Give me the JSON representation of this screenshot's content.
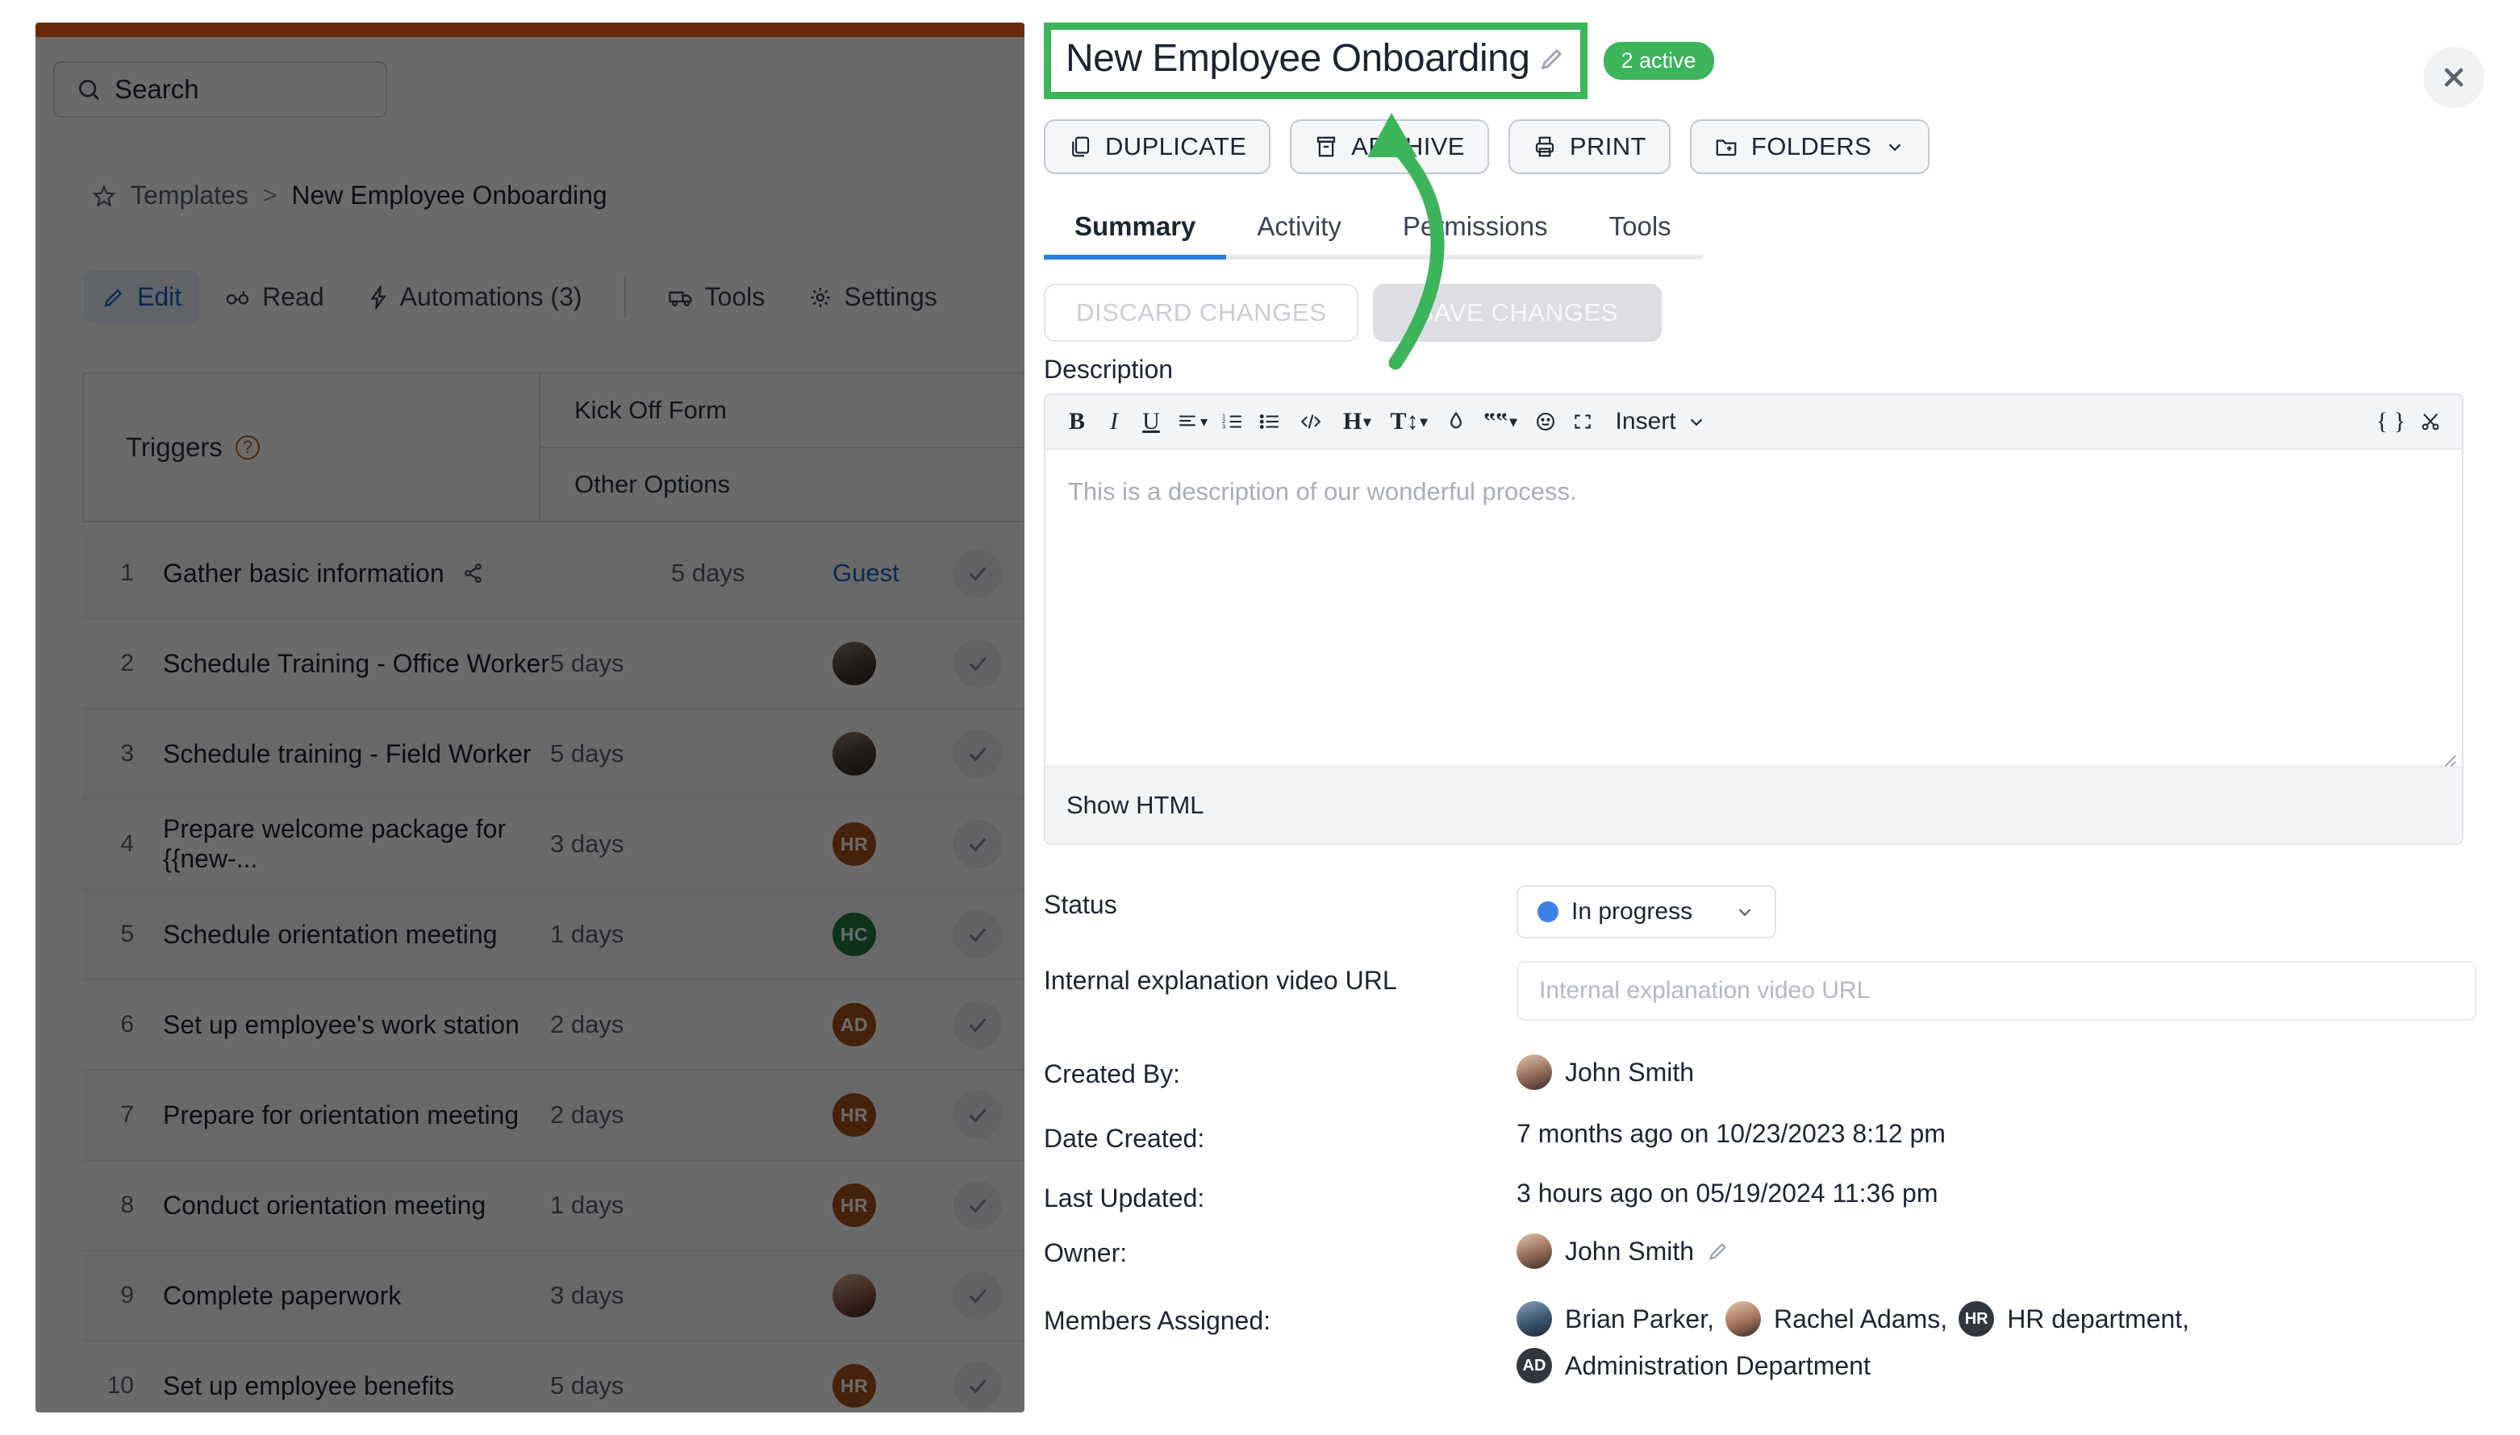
{
  "background_app": {
    "search": {
      "placeholder": "Search",
      "icon": "search-icon"
    },
    "breadcrumb": {
      "star_icon": "star-icon",
      "root": "Templates",
      "separator": ">",
      "current": "New Employee Onboarding"
    },
    "nav_tabs": [
      {
        "label": "Edit",
        "icon": "pencil-icon",
        "active": true
      },
      {
        "label": "Read",
        "icon": "glasses-icon",
        "active": false
      },
      {
        "label": "Automations (3)",
        "icon": "lightning-icon",
        "active": false
      },
      {
        "label": "Tools",
        "icon": "truck-icon",
        "active": false
      },
      {
        "label": "Settings",
        "icon": "gear-icon",
        "active": false
      }
    ],
    "triggers": {
      "label": "Triggers",
      "help_icon": "question-icon",
      "rows": [
        "Kick Off Form",
        "Other Options"
      ]
    },
    "tasks": [
      {
        "num": "1",
        "name": "Gather basic information",
        "share_icon": "share-icon",
        "days": "5 days",
        "assignee": "Guest",
        "assignee_type": "guest"
      },
      {
        "num": "2",
        "name": "Schedule Training - Office Worker",
        "days": "5 days",
        "assignee": "",
        "assignee_type": "photo"
      },
      {
        "num": "3",
        "name": "Schedule training - Field Worker",
        "days": "5 days",
        "assignee": "",
        "assignee_type": "photo"
      },
      {
        "num": "4",
        "name": "Prepare welcome package for {{new-...",
        "days": "3 days",
        "assignee": "HR",
        "assignee_type": "initials-orange"
      },
      {
        "num": "5",
        "name": "Schedule orientation meeting",
        "days": "1 days",
        "assignee": "HC",
        "assignee_type": "initials-green"
      },
      {
        "num": "6",
        "name": "Set up employee's work station",
        "days": "2 days",
        "assignee": "AD",
        "assignee_type": "initials-orange"
      },
      {
        "num": "7",
        "name": "Prepare for orientation meeting",
        "days": "2 days",
        "assignee": "HR",
        "assignee_type": "initials-orange"
      },
      {
        "num": "8",
        "name": "Conduct orientation meeting",
        "days": "1 days",
        "assignee": "HR",
        "assignee_type": "initials-orange"
      },
      {
        "num": "9",
        "name": "Complete paperwork",
        "days": "3 days",
        "assignee": "",
        "assignee_type": "photo2"
      },
      {
        "num": "10",
        "name": "Set up employee benefits",
        "days": "5 days",
        "assignee": "HR",
        "assignee_type": "initials-orange"
      }
    ]
  },
  "modal": {
    "title": "New Employee Onboarding",
    "title_edit_icon": "pencil-icon",
    "active_badge": "2 active",
    "close_icon": "close-icon",
    "highlight_color": "#3cb45a",
    "accent_color": "#2a7fe0",
    "actions": [
      {
        "label": "DUPLICATE",
        "icon": "copy-icon"
      },
      {
        "label": "ARCHIVE",
        "icon": "archive-icon"
      },
      {
        "label": "PRINT",
        "icon": "printer-icon"
      },
      {
        "label": "FOLDERS",
        "icon": "folder-plus-icon",
        "caret": "chevron-down-icon"
      }
    ],
    "tabs": [
      {
        "label": "Summary",
        "active": true
      },
      {
        "label": "Activity",
        "active": false
      },
      {
        "label": "Permissions",
        "active": false
      },
      {
        "label": "Tools",
        "active": false
      }
    ],
    "discard_label": "DISCARD CHANGES",
    "save_label": "SAVE CHANGES",
    "description": {
      "label": "Description",
      "placeholder": "This is a description of our wonderful process.",
      "show_html_label": "Show HTML",
      "toolbar": [
        {
          "name": "bold-icon",
          "glyph": "B"
        },
        {
          "name": "italic-icon",
          "glyph": "I"
        },
        {
          "name": "underline-icon",
          "glyph": "U"
        },
        {
          "name": "align-icon",
          "glyph": "≡",
          "caret": true
        },
        {
          "name": "ordered-list-icon",
          "glyph": "list"
        },
        {
          "name": "bullet-list-icon",
          "glyph": "bullets"
        },
        {
          "name": "code-icon",
          "glyph": "</>"
        },
        {
          "name": "heading-icon",
          "glyph": "H",
          "caret": true
        },
        {
          "name": "font-size-icon",
          "glyph": "T↕",
          "caret": true
        },
        {
          "name": "text-color-icon",
          "glyph": "drop"
        },
        {
          "name": "quote-icon",
          "glyph": "““",
          "caret": true
        },
        {
          "name": "emoji-icon",
          "glyph": "☺"
        },
        {
          "name": "fullscreen-icon",
          "glyph": "[ ]"
        }
      ],
      "insert_label": "Insert",
      "insert_caret": "chevron-down-icon",
      "right_tools": [
        {
          "name": "code-braces-icon",
          "glyph": "{ }"
        },
        {
          "name": "scissors-icon",
          "glyph": "✂"
        }
      ]
    },
    "fields": {
      "status": {
        "label": "Status",
        "value": "In progress",
        "dot_color": "#3b82e6",
        "caret": "chevron-down-icon"
      },
      "video_url": {
        "label": "Internal explanation video URL",
        "placeholder": "Internal explanation video URL",
        "value": ""
      },
      "created_by": {
        "label": "Created By:",
        "value": "John Smith"
      },
      "date_created": {
        "label": "Date Created:",
        "value": "7 months ago on 10/23/2023 8:12 pm"
      },
      "last_updated": {
        "label": "Last Updated:",
        "value": "3 hours ago on 05/19/2024 11:36 pm"
      },
      "owner": {
        "label": "Owner:",
        "value": "John Smith",
        "edit_icon": "pencil-icon"
      },
      "members": {
        "label": "Members Assigned:",
        "list": [
          {
            "name": "Brian Parker,",
            "avatar_type": "photo"
          },
          {
            "name": "Rachel Adams,",
            "avatar_type": "photo"
          },
          {
            "name": "HR department,",
            "avatar_type": "initials",
            "initials": "HR"
          },
          {
            "name": "Administration Department",
            "avatar_type": "initials",
            "initials": "AD"
          }
        ]
      }
    }
  }
}
